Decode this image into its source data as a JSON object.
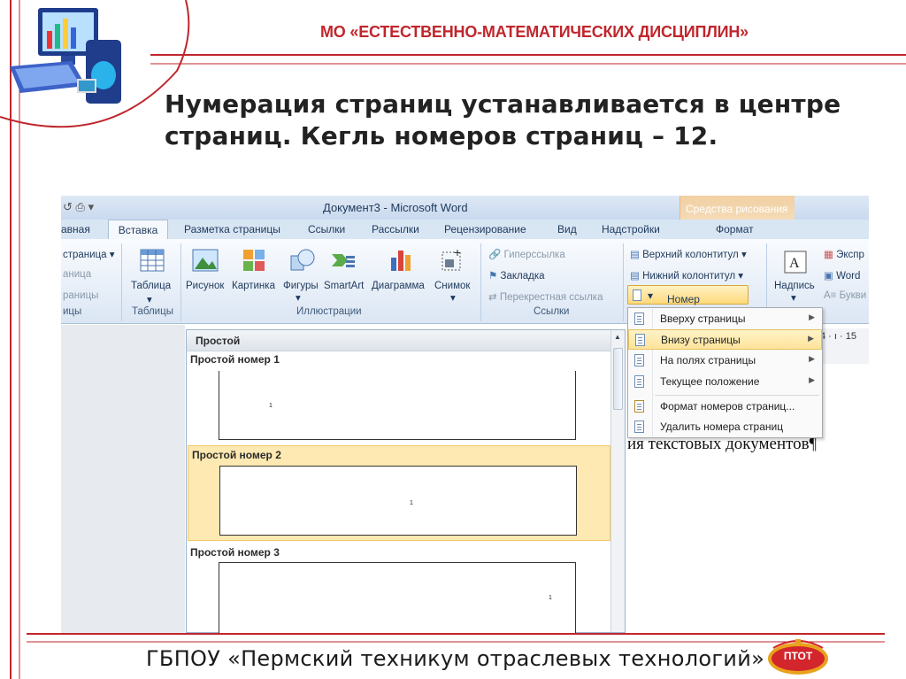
{
  "slide": {
    "header": "МО «ЕСТЕСТВЕННО-МАТЕМАТИЧЕСКИХ ДИСЦИПЛИН»",
    "heading_line1": "Нумерация страниц устанавливается в центре",
    "heading_line2": "страниц. Кегль номеров страниц – 12.",
    "footer": "ГБПОУ «Пермский техникум отраслевых технологий»",
    "logo_text": "ПТОТ",
    "accent_color": "#c0262c"
  },
  "word": {
    "window_title": "Документ3 - Microsoft Word",
    "context_tab_group": "Средства рисования",
    "tabs": [
      "авная",
      "Вставка",
      "Разметка страницы",
      "Ссылки",
      "Рассылки",
      "Рецензирование",
      "Вид",
      "Надстройки",
      "Формат"
    ],
    "active_tab": "Вставка",
    "ribbon": {
      "pages_group": {
        "item1": "страница",
        "item2": "аница",
        "item3": "раницы",
        "label": "ицы"
      },
      "tables_group": {
        "table": "Таблица",
        "label": "Таблицы"
      },
      "illustrations_group": {
        "picture": "Рисунок",
        "clipart": "Картинка",
        "shapes": "Фигуры",
        "smartart": "SmartArt",
        "chart": "Диаграмма",
        "screenshot": "Снимок",
        "label": "Иллюстрации"
      },
      "links_group": {
        "hyperlink": "Гиперссылка",
        "bookmark": "Закладка",
        "crossref": "Перекрестная ссылка",
        "label": "Ссылки"
      },
      "header_footer_group": {
        "header": "Верхний колонтитул",
        "footer": "Нижний колонтитул",
        "page_number": "Номер страницы"
      },
      "text_group": {
        "textbox": "Надпись",
        "express": "Экспр",
        "wordart": "Word",
        "dropcap": "Букви"
      }
    },
    "ruler_text": "4 · ı · 15",
    "gallery": {
      "header": "Простой",
      "items": [
        {
          "label": "Простой номер 1",
          "page_number": "1"
        },
        {
          "label": "Простой номер 2",
          "page_number": "1"
        },
        {
          "label": "Простой номер 3",
          "page_number": "1"
        }
      ],
      "selected_index": 1
    },
    "menu": {
      "items": [
        {
          "label": "Вверху страницы",
          "has_submenu": true
        },
        {
          "label": "Внизу страницы",
          "has_submenu": true
        },
        {
          "label": "На полях страницы",
          "has_submenu": true
        },
        {
          "label": "Текущее положение",
          "has_submenu": true
        },
        {
          "label": "Формат номеров страниц...",
          "has_submenu": false
        },
        {
          "label": "Удалить номера страниц",
          "has_submenu": false
        }
      ],
      "highlighted_index": 1,
      "submenu_arrow": "▶"
    },
    "document_text": "ия текстовых документов¶"
  }
}
